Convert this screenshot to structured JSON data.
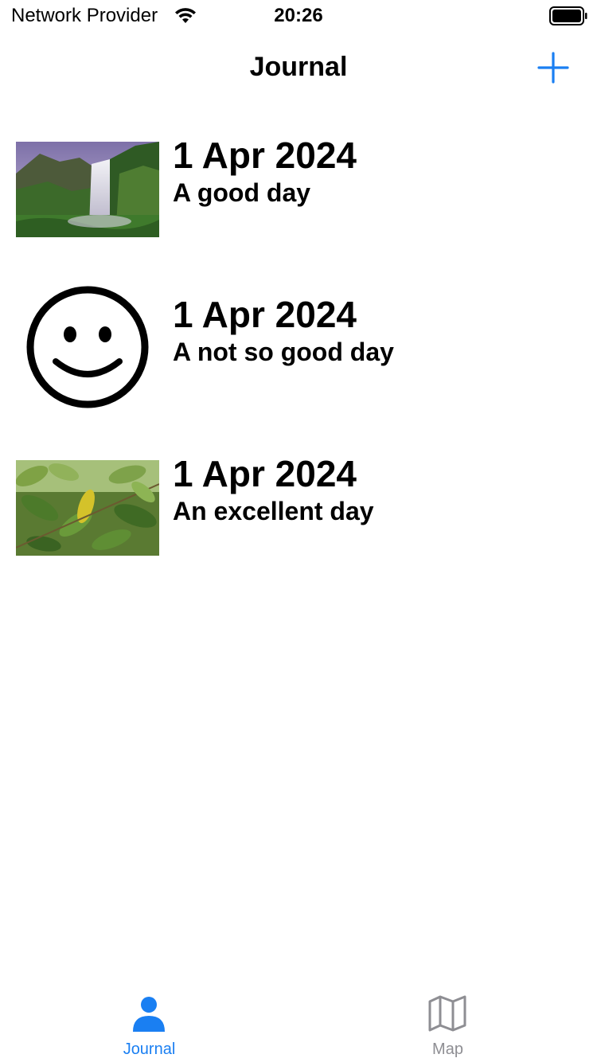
{
  "status_bar": {
    "carrier": "Network Provider",
    "time": "20:26",
    "wifi_icon": "wifi-icon",
    "battery_icon": "battery-full-icon"
  },
  "nav": {
    "title": "Journal",
    "add_icon": "plus-icon"
  },
  "entries": [
    {
      "date": "1 Apr 2024",
      "title": "A good day",
      "thumbnail": "waterfall-photo"
    },
    {
      "date": "1 Apr 2024",
      "title": "A not so good day",
      "thumbnail": "smiley-face-icon"
    },
    {
      "date": "1 Apr 2024",
      "title": "An excellent day",
      "thumbnail": "leaves-photo"
    }
  ],
  "tab_bar": {
    "tabs": [
      {
        "label": "Journal",
        "icon": "person-icon",
        "selected": true
      },
      {
        "label": "Map",
        "icon": "map-icon",
        "selected": false
      }
    ]
  },
  "colors": {
    "accent": "#1a7ff2",
    "inactive": "#8e8e93",
    "text": "#000000",
    "background": "#ffffff"
  }
}
